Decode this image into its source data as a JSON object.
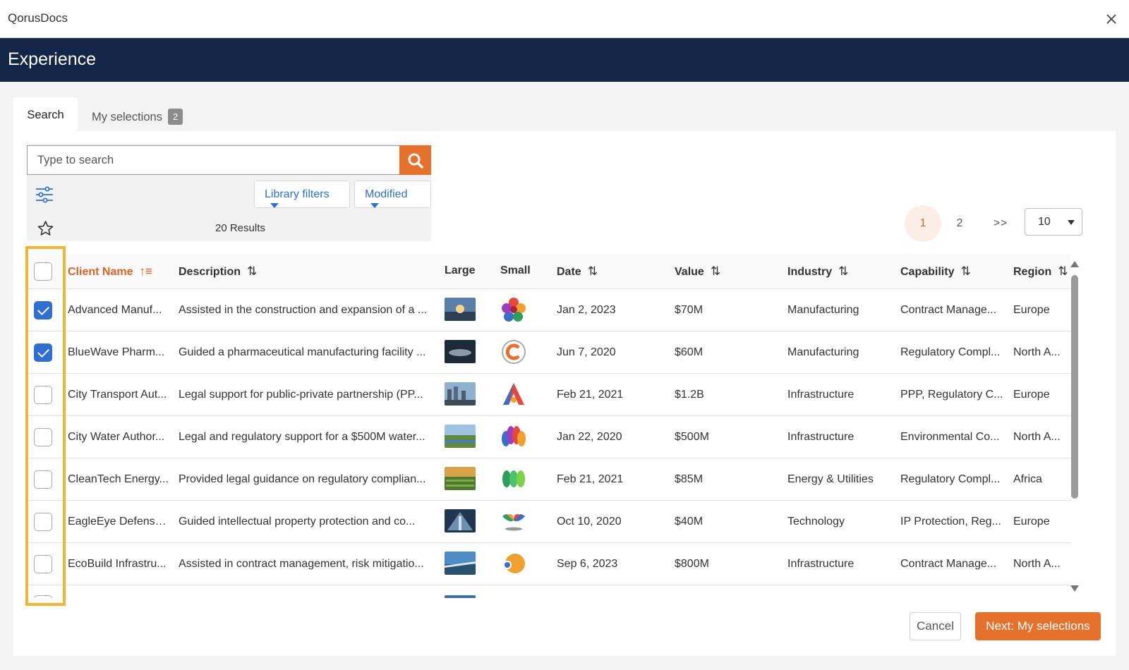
{
  "window": {
    "title": "QorusDocs",
    "close_icon": "close-icon"
  },
  "header": {
    "title": "Experience"
  },
  "tabs": [
    {
      "label": "Search",
      "active": true
    },
    {
      "label": "My selections",
      "badge": "2",
      "active": false
    }
  ],
  "search": {
    "placeholder": "Type to search",
    "value": "",
    "icon": "search-icon"
  },
  "filters": {
    "library_label": "Library filters",
    "modified_label": "Modified",
    "settings_icon": "sliders-icon",
    "favorite_icon": "star-icon"
  },
  "results_text": "20 Results",
  "pagination": {
    "pages": [
      "1",
      "2"
    ],
    "current": "1",
    "next_label": ">>",
    "page_size": "10"
  },
  "table": {
    "columns": [
      {
        "label": "Client Name",
        "sort": "asc",
        "active": true
      },
      {
        "label": "Description",
        "sort": "both"
      },
      {
        "label": "Large"
      },
      {
        "label": "Small"
      },
      {
        "label": "Date",
        "sort": "both"
      },
      {
        "label": "Value",
        "sort": "both"
      },
      {
        "label": "Industry",
        "sort": "both"
      },
      {
        "label": "Capability",
        "sort": "both"
      },
      {
        "label": "Region",
        "sort": "both"
      }
    ],
    "rows": [
      {
        "checked": true,
        "client": "Advanced Manuf...",
        "description": "Assisted in the construction and expansion of a ...",
        "date": "Jan 2, 2023",
        "value": "$70M",
        "industry": "Manufacturing",
        "capability": "Contract Manage...",
        "region": "Europe"
      },
      {
        "checked": true,
        "client": "BlueWave Pharm...",
        "description": "Guided a pharmaceutical manufacturing facility ...",
        "date": "Jun 7, 2020",
        "value": "$60M",
        "industry": "Manufacturing",
        "capability": "Regulatory Compl...",
        "region": "North A..."
      },
      {
        "checked": false,
        "client": "City Transport Aut...",
        "description": "Legal support for public-private partnership (PP...",
        "date": "Feb 21, 2021",
        "value": "$1.2B",
        "industry": "Infrastructure",
        "capability": "PPP, Regulatory C...",
        "region": "Europe"
      },
      {
        "checked": false,
        "client": "City Water Author...",
        "description": "Legal and regulatory support for a $500M water...",
        "date": "Jan 22, 2020",
        "value": "$500M",
        "industry": "Infrastructure",
        "capability": "Environmental Co...",
        "region": "North A..."
      },
      {
        "checked": false,
        "client": "CleanTech Energy...",
        "description": "Provided legal guidance on regulatory complian...",
        "date": "Feb 21, 2021",
        "value": "$85M",
        "industry": "Energy & Utilities",
        "capability": "Regulatory Compl...",
        "region": "Africa"
      },
      {
        "checked": false,
        "client": "EagleEye Defense...",
        "description": "Guided intellectual property protection and co...",
        "date": "Oct 10, 2020",
        "value": "$40M",
        "industry": "Technology",
        "capability": "IP Protection, Reg...",
        "region": "Europe"
      },
      {
        "checked": false,
        "client": "EcoBuild Infrastru...",
        "description": "Assisted in contract management, risk mitigatio...",
        "date": "Sep 6, 2023",
        "value": "$800M",
        "industry": "Infrastructure",
        "capability": "Contract Manage...",
        "region": "North A..."
      }
    ]
  },
  "footer": {
    "cancel_label": "Cancel",
    "next_label": "Next: My selections"
  },
  "colors": {
    "accent": "#e5722c",
    "header_bg": "#142648",
    "link": "#2f6fcf",
    "highlight": "#f3b335"
  }
}
